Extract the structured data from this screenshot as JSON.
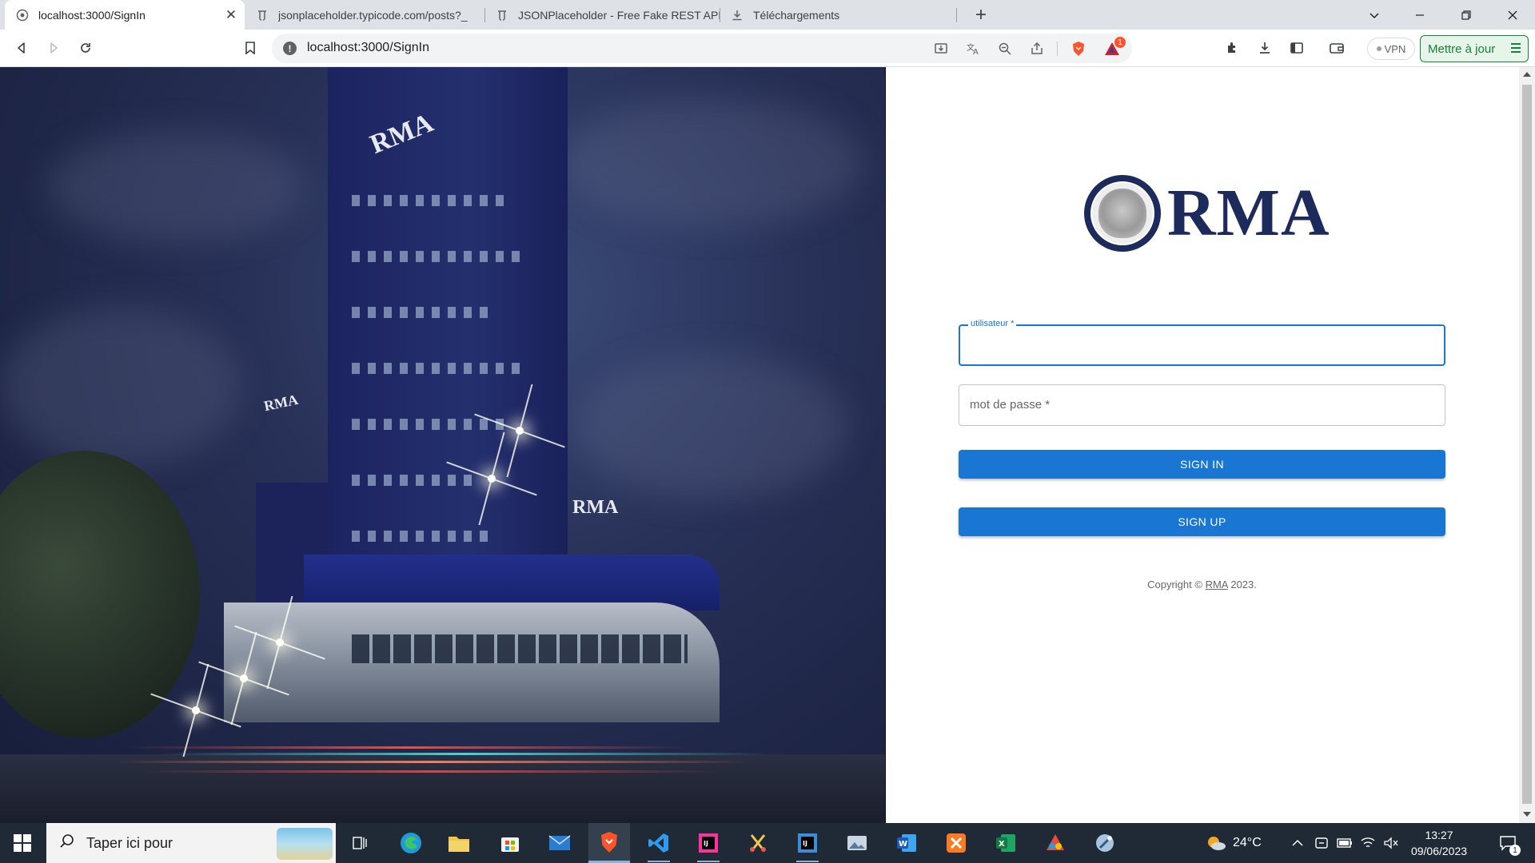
{
  "browser": {
    "tabs": [
      {
        "title": "localhost:3000/SignIn",
        "active": true
      },
      {
        "title": "jsonplaceholder.typicode.com/posts?_",
        "active": false
      },
      {
        "title": "JSONPlaceholder - Free Fake REST API",
        "active": false
      },
      {
        "title": "Téléchargements",
        "active": false
      }
    ],
    "url": "localhost:3000/SignIn",
    "vpn_label": "VPN",
    "update_label": "Mettre à jour",
    "brave_badge": "1",
    "colors": {
      "accent_green": "#188038",
      "brave_orange": "#fb542b"
    }
  },
  "page": {
    "logo_text": "RMA",
    "hero_signs": [
      "RMA",
      "RMA",
      "RMA"
    ],
    "username": {
      "label": "utilisateur *",
      "value": ""
    },
    "password": {
      "label": "mot de passe *",
      "value": ""
    },
    "signin_label": "SIGN IN",
    "signup_label": "SIGN UP",
    "copyright": {
      "prefix": "Copyright © ",
      "link": "RMA",
      "suffix": " 2023."
    },
    "colors": {
      "primary": "#1976d2",
      "brand_navy": "#1c2a5c"
    }
  },
  "taskbar": {
    "search_placeholder": "Taper ici pour",
    "apps": [
      "task-view",
      "edge",
      "file-explorer",
      "microsoft-store",
      "mail",
      "brave",
      "vscode",
      "intellij-idea",
      "snipping-tool",
      "intellij-community",
      "photos",
      "word",
      "xampp",
      "excel",
      "paint",
      "settings"
    ],
    "weather": "24°C",
    "time": "13:27",
    "date": "09/06/2023",
    "notifications": "1"
  }
}
